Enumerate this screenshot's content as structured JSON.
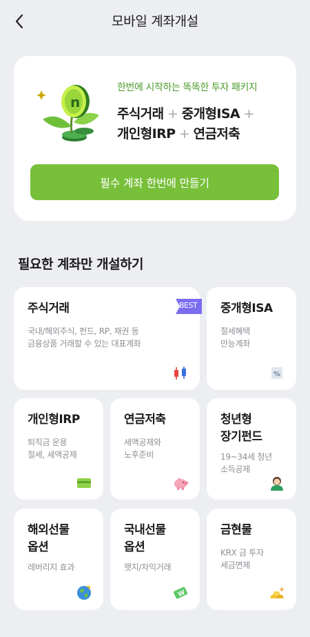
{
  "header": {
    "title": "모바일 계좌개설"
  },
  "promo": {
    "tagline": "한번에 시작하는 똑똑한 투자 패키지",
    "line1_item1": "주식거래",
    "line1_plus1": " + ",
    "line1_item2": "중개형ISA",
    "line1_plus2": " +",
    "line2_item1": "개인형IRP",
    "line2_plus1": " + ",
    "line2_item2": "연금저축",
    "button_label": "필수 계좌 한번에 만들기"
  },
  "section": {
    "title": "필요한 계좌만 개설하기"
  },
  "tiles": [
    {
      "title": "주식거래",
      "desc": "국내/해외주식, 펀드, RP, 채권 등\n금융상품 거래할 수 있는 대표계좌",
      "badge": "BEST",
      "icon": "candlestick-icon"
    },
    {
      "title": "중개형ISA",
      "desc": "절세혜택\n만능계좌",
      "icon": "percent-receipt-icon"
    },
    {
      "title": "개인형IRP",
      "desc": "퇴직금 운용\n절세, 세액공제",
      "icon": "card-icon"
    },
    {
      "title": "연금저축",
      "desc": "세액공제와\n노후준비",
      "icon": "piggy-bank-icon"
    },
    {
      "title": "청년형\n장기펀드",
      "desc": "19~34세 청년\n소득공제",
      "icon": "person-icon"
    },
    {
      "title": "해외선물\n옵션",
      "desc": "레버리지 효과",
      "icon": "globe-icon"
    },
    {
      "title": "국내선물\n옵션",
      "desc": "햇지/차익거래",
      "icon": "won-banknote-icon"
    },
    {
      "title": "금현물",
      "desc": "KRX 금 투자\n세금면제",
      "icon": "gold-bars-icon"
    }
  ],
  "colors": {
    "background": "#eceef2",
    "accent_green": "#78bf3a",
    "tagline_green": "#4a9b2b",
    "badge_purple": "#7b6cf0"
  }
}
